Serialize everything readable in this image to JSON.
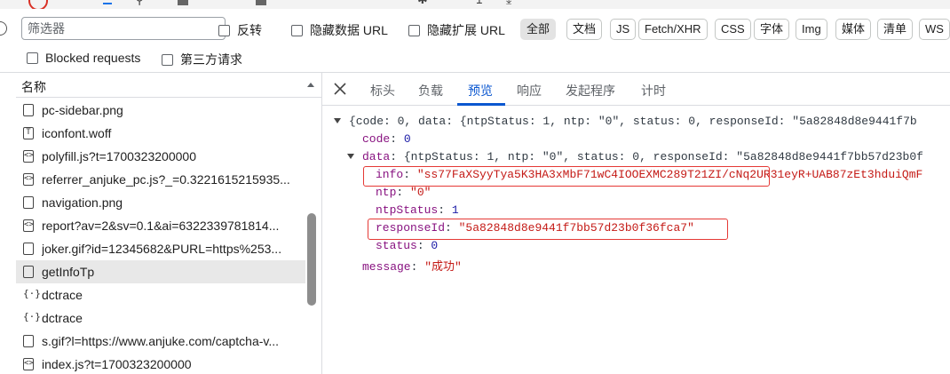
{
  "filter": {
    "placeholder": "筛选器",
    "invert": "反转",
    "hide_data_urls": "隐藏数据 URL",
    "hide_ext_urls": "隐藏扩展 URL",
    "types": [
      "全部",
      "文档",
      "JS",
      "Fetch/XHR",
      "CSS",
      "字体",
      "Img",
      "媒体",
      "清单",
      "WS"
    ],
    "active_type": "全部",
    "blocked_requests": "Blocked requests",
    "third_party": "第三方请求"
  },
  "list": {
    "header": "名称",
    "rows": [
      {
        "name": "pc-sidebar.png",
        "icon": "image-file-icon"
      },
      {
        "name": "iconfont.woff",
        "icon": "font-file-icon"
      },
      {
        "name": "polyfill.js?t=1700323200000",
        "icon": "script-file-icon"
      },
      {
        "name": "referrer_anjuke_pc.js?_=0.3221615215935...",
        "icon": "script-file-icon"
      },
      {
        "name": "navigation.png",
        "icon": "image-file-icon"
      },
      {
        "name": "report?av=2&sv=0.1&ai=6322339781814...",
        "icon": "script-file-icon"
      },
      {
        "name": "joker.gif?id=12345682&PURL=https%253...",
        "icon": "image-file-icon"
      },
      {
        "name": "getInfoTp",
        "icon": "document-file-icon"
      },
      {
        "name": "dctrace",
        "icon": "fetch-icon"
      },
      {
        "name": "dctrace",
        "icon": "fetch-icon"
      },
      {
        "name": "s.gif?l=https://www.anjuke.com/captcha-v...",
        "icon": "image-file-icon"
      },
      {
        "name": "index.js?t=1700323200000",
        "icon": "script-file-icon"
      }
    ],
    "selected": "getInfoTp"
  },
  "tabs": [
    "标头",
    "负载",
    "预览",
    "响应",
    "发起程序",
    "计时"
  ],
  "active_tab": "预览",
  "preview": {
    "line1": "{code: 0, data: {ntpStatus: 1, ntp: \"0\", status: 0, responseId: \"5a82848d8e9441f7b",
    "code_key": "code",
    "code_val": "0",
    "data_key": "data",
    "data_summary": "{ntpStatus: 1, ntp: \"0\", status: 0, responseId: \"5a82848d8e9441f7bb57d23b0f",
    "info_key": "info",
    "info_val": "\"ss77FaXSyyTya5K3HA3xMbF71wC4IOOEXMC289T21ZI/cNq2UR31eyR+UAB87zEt3hduiQmF",
    "ntp_key": "ntp",
    "ntp_val": "\"0\"",
    "ntpStatus_key": "ntpStatus",
    "ntpStatus_val": "1",
    "responseId_key": "responseId",
    "responseId_val": "\"5a82848d8e9441f7bb57d23b0f36fca7\"",
    "status_key": "status",
    "status_val": "0",
    "message_key": "message",
    "message_val": "\"成功\""
  },
  "colors": {
    "accent": "#0b57d0",
    "highlight_box": "#e53935",
    "key": "#881280",
    "string": "#c41a16",
    "number": "#1a1aa6"
  }
}
